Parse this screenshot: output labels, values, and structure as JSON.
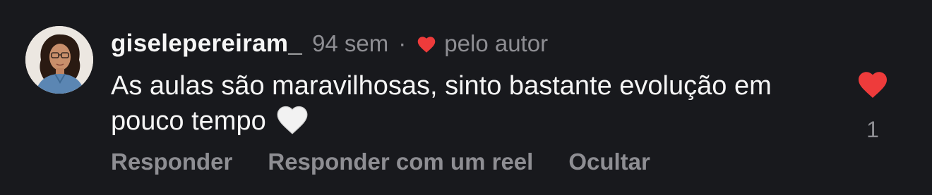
{
  "comment": {
    "avatar_icon": "user-avatar",
    "username": "giselepereiram_",
    "time": "94 sem",
    "separator": "·",
    "liked_by_author_icon": "heart-icon",
    "liked_by_author_label": "pelo autor",
    "text": "As aulas são maravilhosas, sinto bastante evolução em pouco tempo",
    "emoji": "white-heart-emoji",
    "like_icon": "heart-filled-icon",
    "like_count": "1",
    "actions": {
      "reply": "Responder",
      "reply_reel": "Responder com um reel",
      "hide": "Ocultar"
    }
  },
  "colors": {
    "background": "#18191d",
    "primary_text": "#f5f5f5",
    "secondary_text": "#8e8e93",
    "heart_red": "#ee3b3b"
  }
}
